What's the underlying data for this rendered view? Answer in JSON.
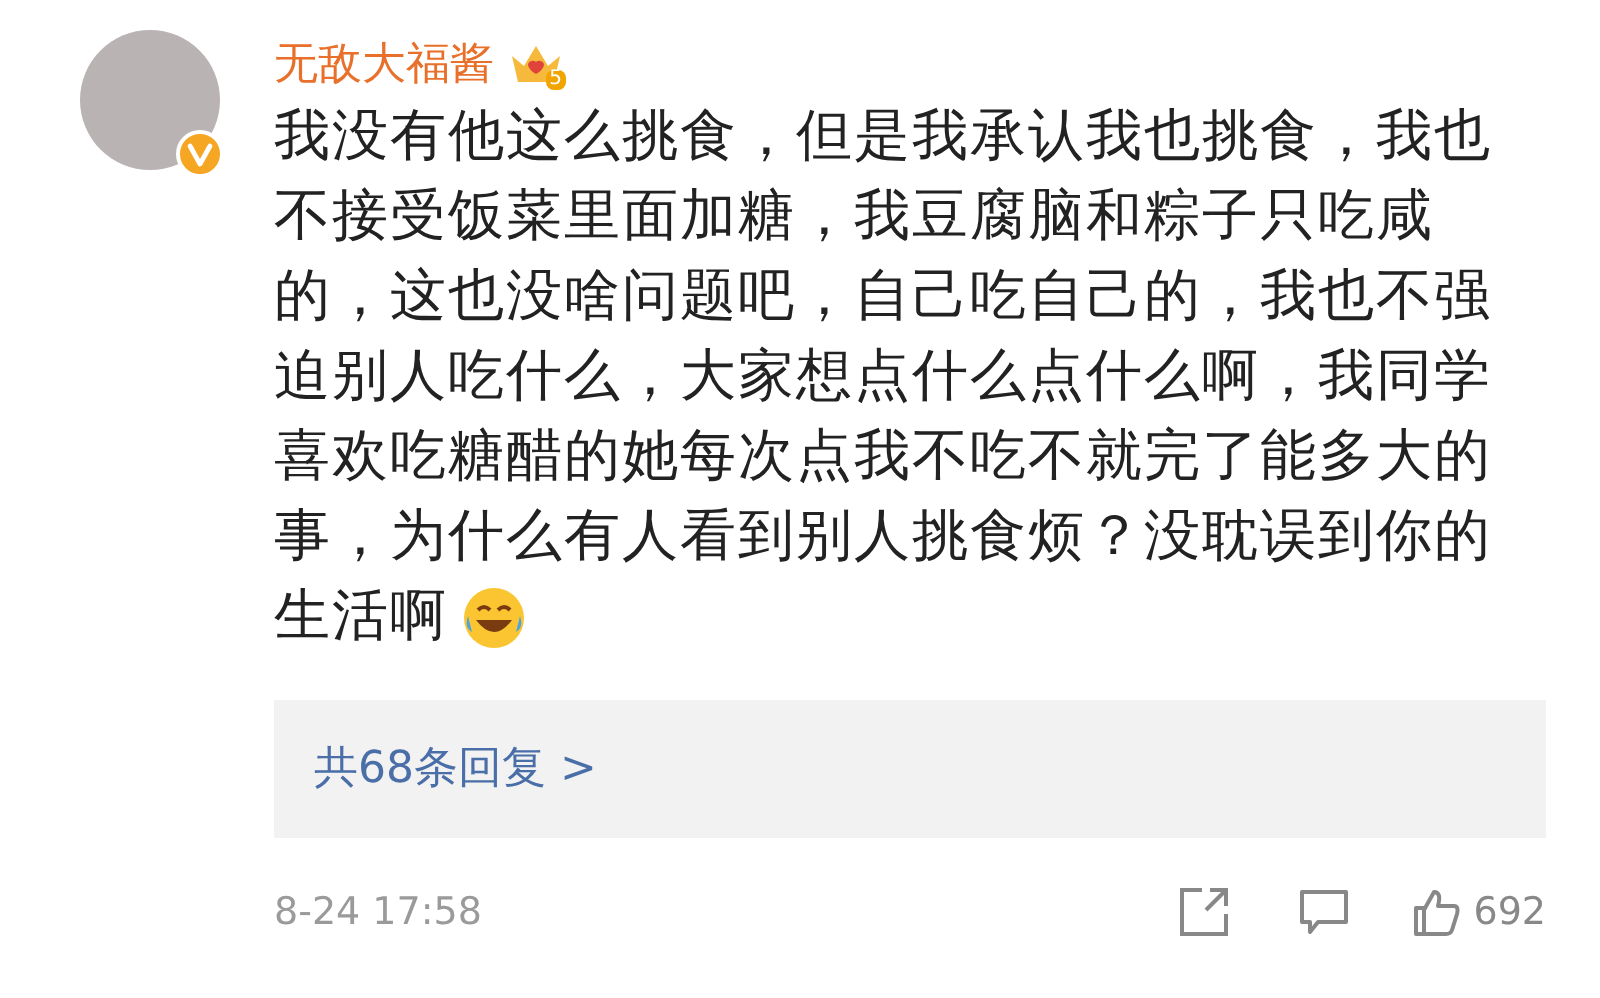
{
  "author": {
    "name": "无敌大福酱",
    "verified": true,
    "vip_level": "5"
  },
  "comment": {
    "text": "我没有他这么挑食，但是我承认我也挑食，我也不接受饭菜里面加糖，我豆腐脑和粽子只吃咸的，这也没啥问题吧，自己吃自己的，我也不强迫别人吃什么，大家想点什么点什么啊，我同学喜欢吃糖醋的她每次点我不吃不就完了能多大的事，为什么有人看到别人挑食烦？没耽误到你的生活啊"
  },
  "replies": {
    "label": "共68条回复 >"
  },
  "footer": {
    "time": "8-24 17:58",
    "likes": "692"
  }
}
